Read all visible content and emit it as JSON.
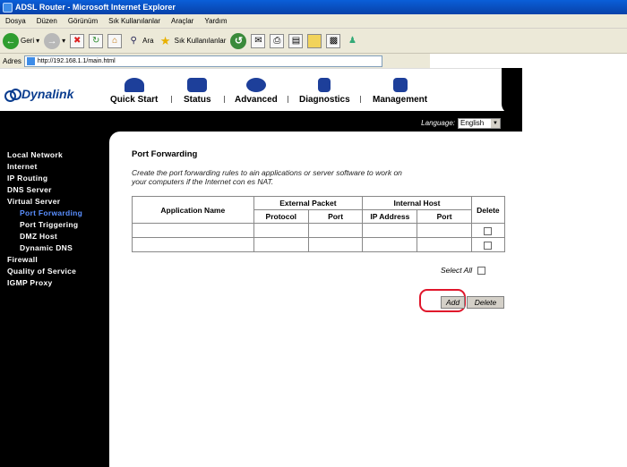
{
  "window": {
    "title": "ADSL Router - Microsoft Internet Explorer"
  },
  "menu": [
    "Dosya",
    "Düzen",
    "Görünüm",
    "Sık Kullanılanlar",
    "Araçlar",
    "Yardım"
  ],
  "toolbar": {
    "back_label": "Geri",
    "search_label": "Ara",
    "favorites_label": "Sık Kullanılanlar"
  },
  "address": {
    "label": "Adres",
    "url": "http://192.168.1.1/main.html"
  },
  "brand": {
    "logo_text": "Dynalink"
  },
  "nav": [
    "Quick Start",
    "Status",
    "Advanced",
    "Diagnostics",
    "Management"
  ],
  "language": {
    "label": "Language:",
    "value": "English"
  },
  "sidebar": {
    "items": [
      {
        "label": "Local Network",
        "sub": false
      },
      {
        "label": "Internet",
        "sub": false
      },
      {
        "label": "IP Routing",
        "sub": false
      },
      {
        "label": "DNS Server",
        "sub": false
      },
      {
        "label": "Virtual Server",
        "sub": false
      },
      {
        "label": "Port Forwarding",
        "sub": true,
        "active": true
      },
      {
        "label": "Port Triggering",
        "sub": true
      },
      {
        "label": "DMZ Host",
        "sub": true
      },
      {
        "label": "Dynamic DNS",
        "sub": true
      },
      {
        "label": "Firewall",
        "sub": false
      },
      {
        "label": "Quality of Service",
        "sub": false
      },
      {
        "label": "IGMP Proxy",
        "sub": false
      }
    ]
  },
  "main": {
    "title": "Port Forwarding",
    "description_line1": "Create the port forwarding rules to          ain applications or server software to work on",
    "description_line2": "your computers if the Internet con          es NAT.",
    "table": {
      "col_app": "Application Name",
      "group_external": "External Packet",
      "group_internal": "Internal Host",
      "col_delete": "Delete",
      "col_protocol": "Protocol",
      "col_port": "Port",
      "col_ip": "IP Address",
      "col_port2": "Port"
    },
    "select_all_label": "Select All",
    "add_label": "Add",
    "delete_label": "Delete"
  }
}
